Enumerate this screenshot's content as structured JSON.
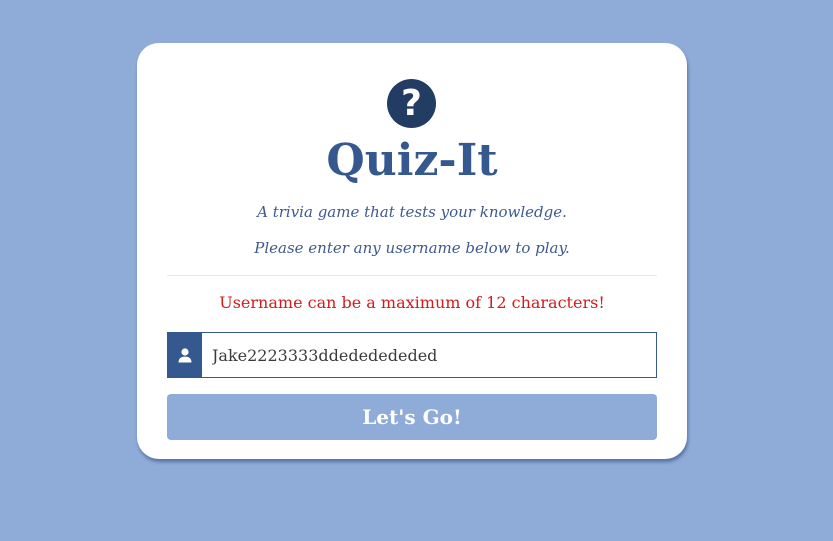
{
  "colors": {
    "page_background": "#8fabd8",
    "card_background": "#ffffff",
    "accent": "#35588f",
    "logo_background": "#233c64",
    "error": "#d01c1c",
    "button_background": "#8fabd8",
    "button_text": "#ffffff"
  },
  "card": {
    "logo_icon": "question-mark-circle-icon",
    "logo_glyph": "?",
    "title": "Quiz-It",
    "subtitle_line1": "A trivia game that tests your knowledge.",
    "subtitle_line2": "Please enter any username below to play.",
    "error_message": "Username can be a maximum of 12 characters!",
    "username": {
      "icon": "user-icon",
      "value": "Jake2223333ddededededed"
    },
    "submit_label": "Let's Go!"
  }
}
